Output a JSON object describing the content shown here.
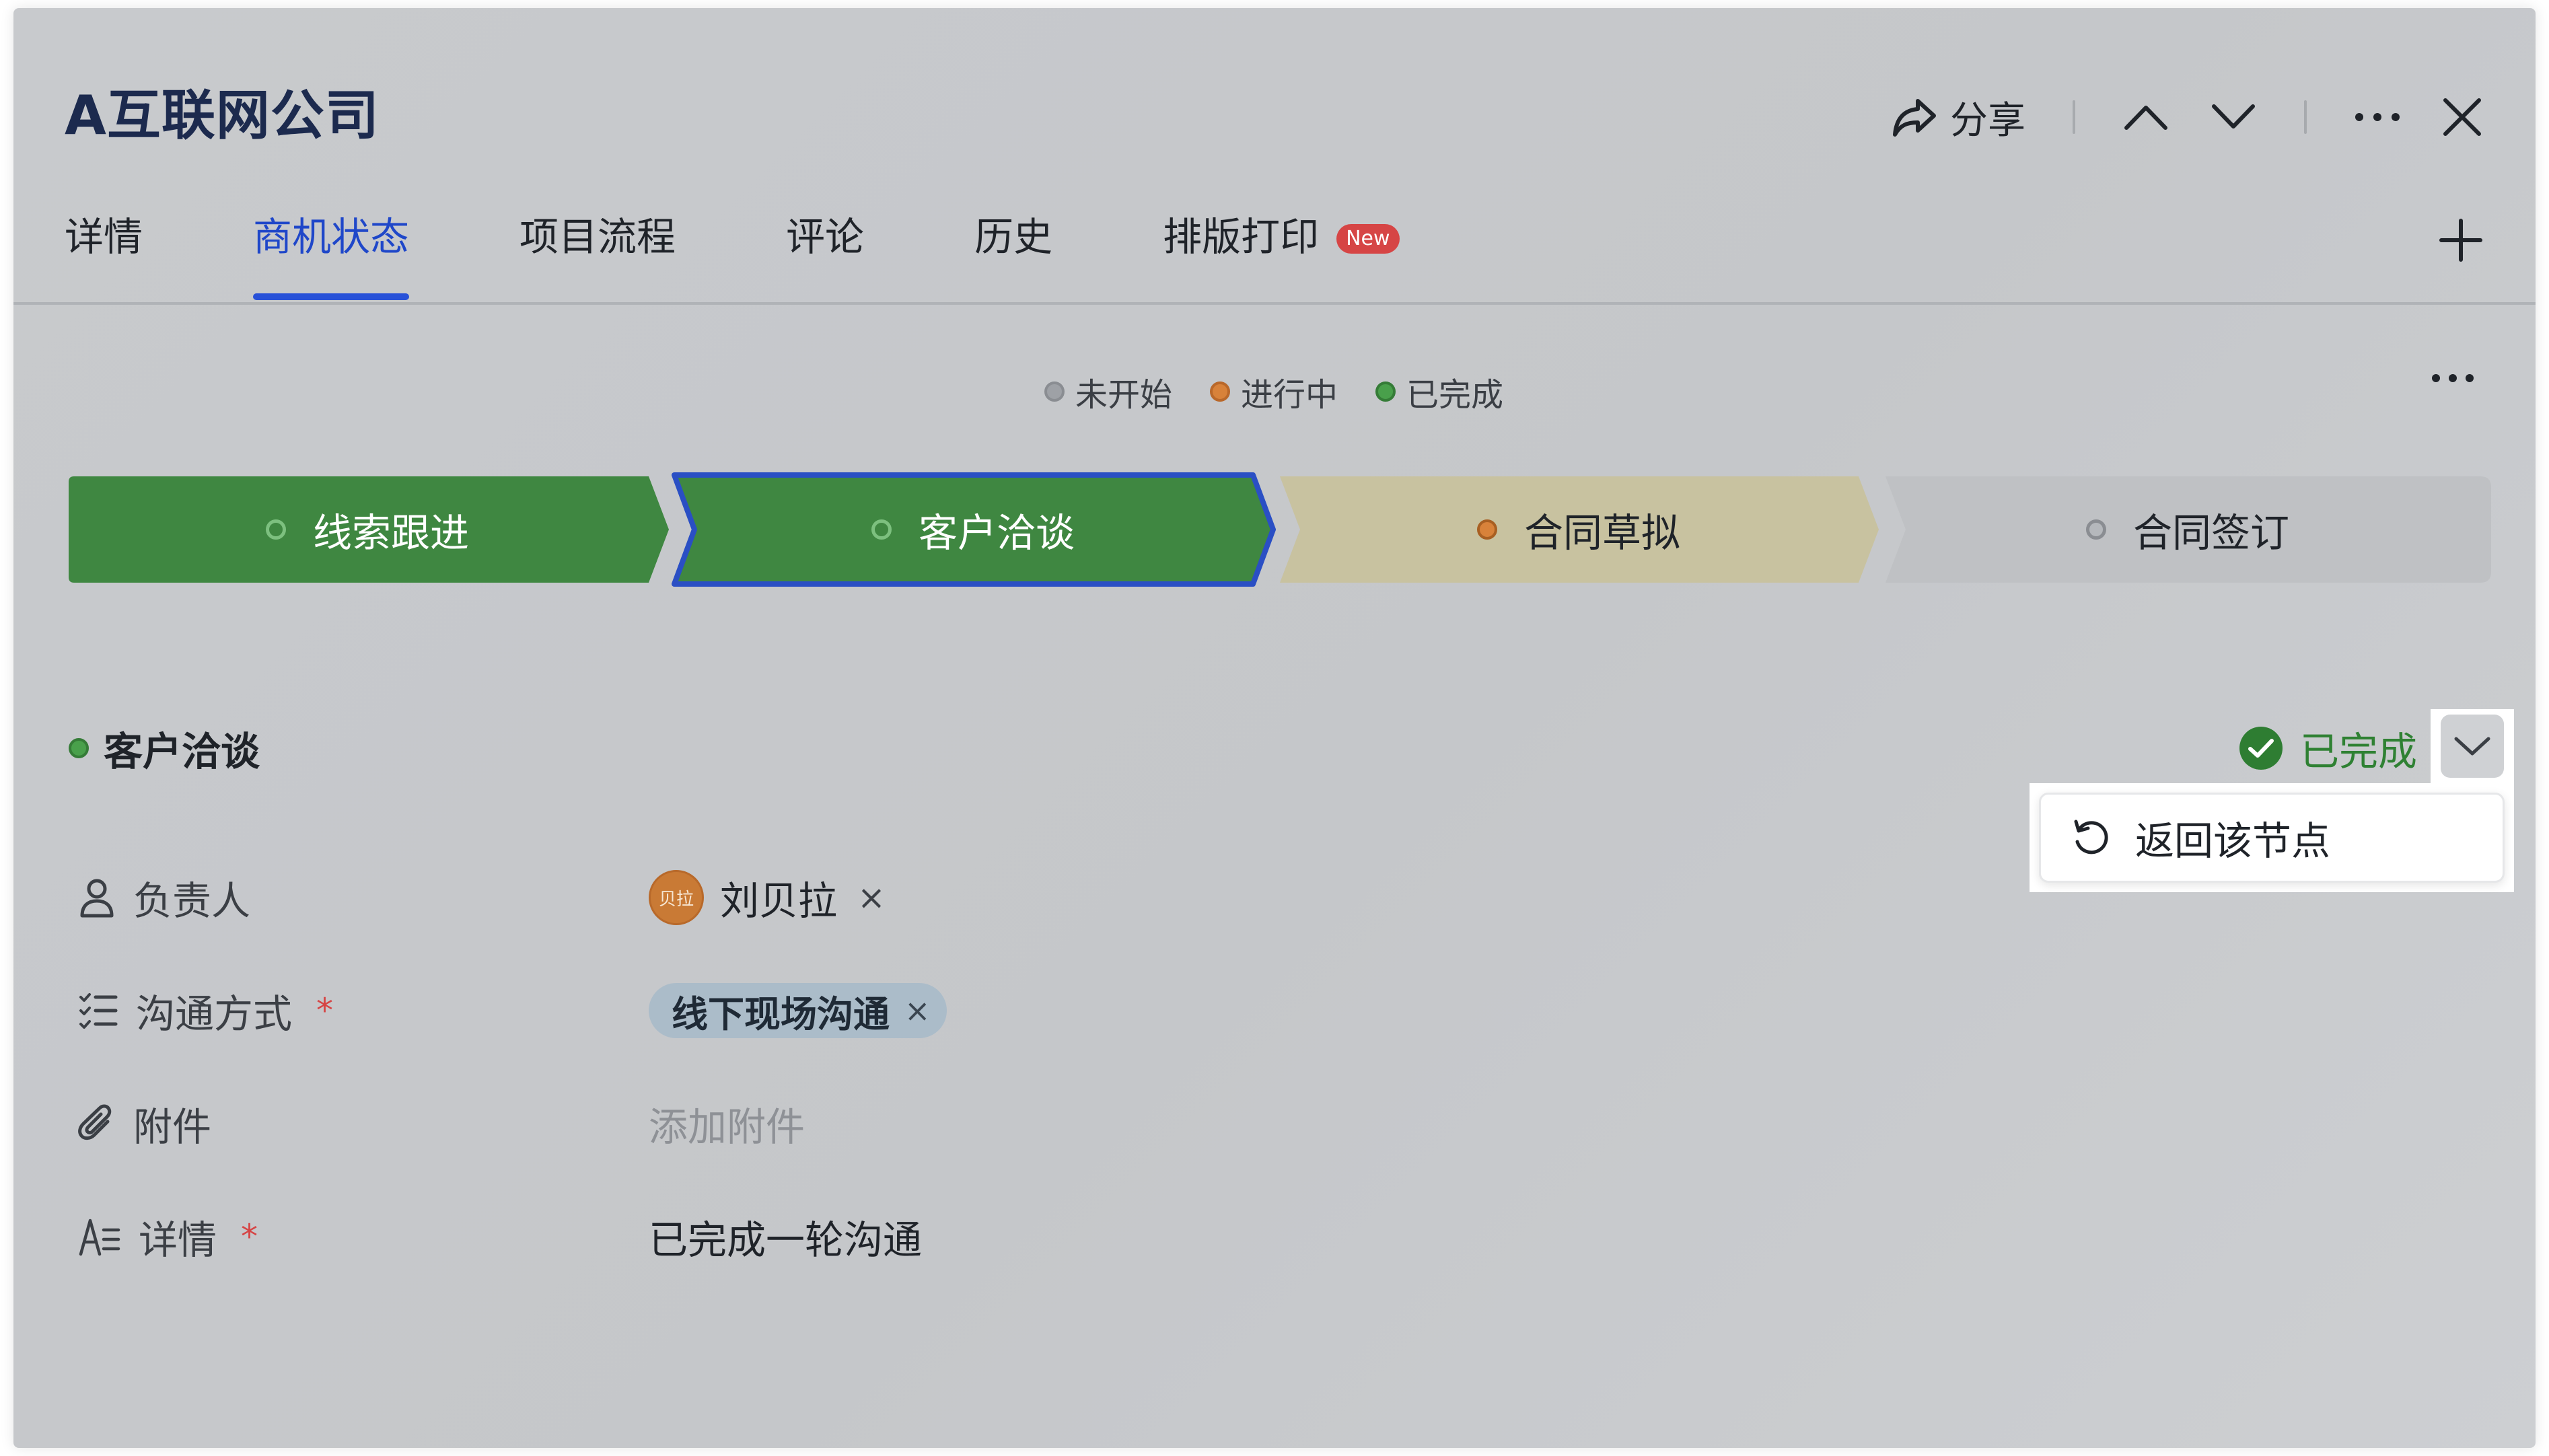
{
  "header": {
    "title": "A互联网公司",
    "share_label": "分享"
  },
  "tabs": [
    {
      "label": "详情",
      "active": false
    },
    {
      "label": "商机状态",
      "active": true
    },
    {
      "label": "项目流程",
      "active": false
    },
    {
      "label": "评论",
      "active": false
    },
    {
      "label": "历史",
      "active": false
    },
    {
      "label": "排版打印",
      "active": false,
      "badge": "New"
    }
  ],
  "legend": [
    {
      "label": "未开始",
      "color": "#9ea1a6"
    },
    {
      "label": "进行中",
      "color": "#d8823a"
    },
    {
      "label": "已完成",
      "color": "#49a04b"
    }
  ],
  "stages": [
    {
      "label": "线索跟进",
      "status": "completed",
      "color": "#3f8741"
    },
    {
      "label": "客户洽谈",
      "status": "completed",
      "selected": true,
      "color": "#3f8741",
      "border": "#2a4fc4"
    },
    {
      "label": "合同草拟",
      "status": "in-progress",
      "color": "#c8c2a0"
    },
    {
      "label": "合同签订",
      "status": "not-started",
      "color": "#bfc1c4"
    }
  ],
  "section": {
    "title": "客户洽谈",
    "status_label": "已完成",
    "status_color": "#2f8133"
  },
  "dropdown_menu": {
    "items": [
      {
        "label": "返回该节点",
        "icon": "undo-icon"
      }
    ]
  },
  "fields": {
    "owner": {
      "label": "负责人",
      "icon": "user-icon",
      "avatar_text": "贝拉",
      "value": "刘贝拉",
      "remove": "×"
    },
    "communication": {
      "label": "沟通方式",
      "icon": "checklist-icon",
      "required": "*",
      "value": "线下现场沟通",
      "remove": "×"
    },
    "attachment": {
      "label": "附件",
      "icon": "paperclip-icon",
      "placeholder": "添加附件"
    },
    "details": {
      "label": "详情",
      "icon": "text-format-icon",
      "required": "*",
      "value": "已完成一轮沟通"
    }
  }
}
